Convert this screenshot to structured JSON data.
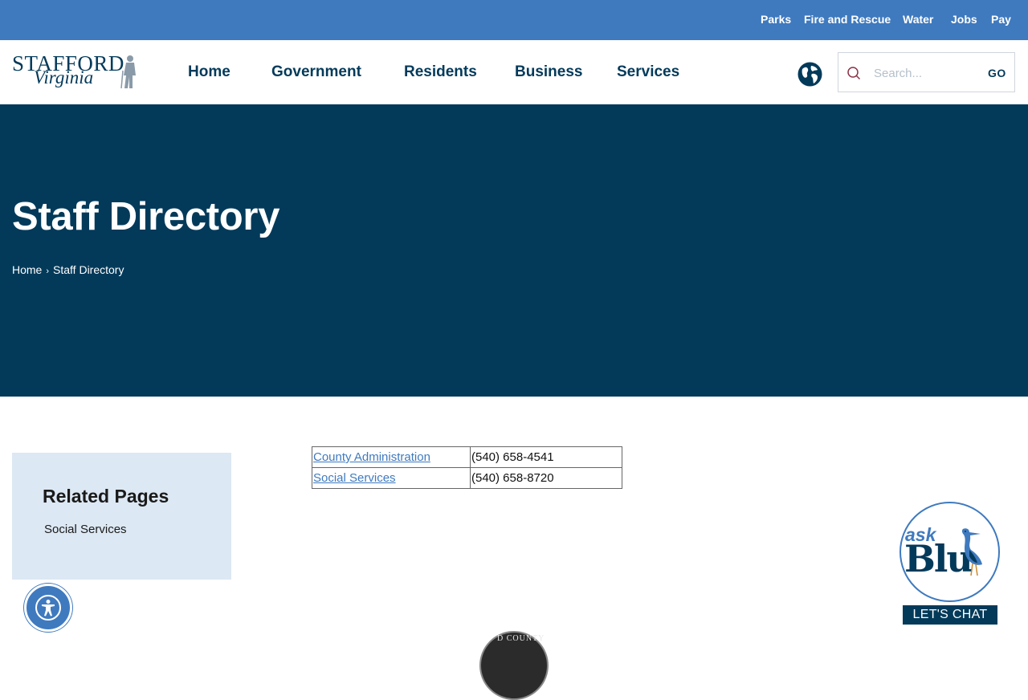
{
  "utility_nav": {
    "items": [
      {
        "label": "Parks"
      },
      {
        "label": "Fire and Rescue"
      },
      {
        "label": "Water"
      },
      {
        "label": "Jobs"
      },
      {
        "label": "Pay"
      }
    ]
  },
  "logo": {
    "line1": "STAFFORD",
    "line2": "Virginia"
  },
  "main_nav": {
    "items": [
      {
        "label": "Home"
      },
      {
        "label": "Government"
      },
      {
        "label": "Residents"
      },
      {
        "label": "Business"
      },
      {
        "label": "Services"
      }
    ]
  },
  "search": {
    "placeholder": "Search...",
    "button_label": "GO"
  },
  "hero": {
    "title": "Staff Directory",
    "breadcrumb": {
      "home": "Home",
      "separator": "›",
      "current": "Staff Directory"
    }
  },
  "related": {
    "title": "Related Pages",
    "items": [
      {
        "label": "Social Services"
      }
    ]
  },
  "directory": {
    "rows": [
      {
        "name": "County Administration",
        "phone": "(540) 658-4541"
      },
      {
        "name": "Social Services",
        "phone": "(540) 658-8720"
      }
    ]
  },
  "chat": {
    "ask": "ask",
    "blu": "Blu",
    "cta": "LET'S CHAT"
  },
  "seal": {
    "text": "D COUNTY"
  },
  "colors": {
    "utility_bar": "#3f7abf",
    "navy": "#033a5a",
    "related_bg": "#dce8f3",
    "link": "#3f7abf"
  }
}
